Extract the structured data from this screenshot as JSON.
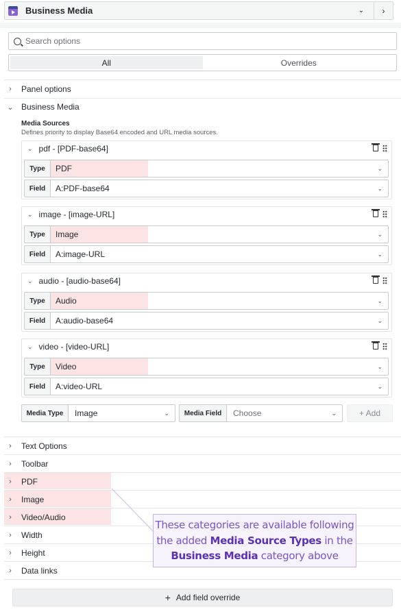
{
  "header": {
    "title": "Business Media",
    "collapse_icon": "chevron-down-icon",
    "next_icon": "chevron-right-icon"
  },
  "search": {
    "placeholder": "Search options",
    "value": ""
  },
  "tabs": [
    {
      "label": "All",
      "active": true
    },
    {
      "label": "Overrides",
      "active": false
    }
  ],
  "categories_top": [
    {
      "label": "Panel options",
      "expanded": false
    },
    {
      "label": "Business Media",
      "expanded": true
    }
  ],
  "media_sources": {
    "label": "Media Sources",
    "description": "Defines priority to display Base64 encoded and URL media sources.",
    "type_key": "Type",
    "field_key": "Field",
    "items": [
      {
        "title": "pdf - [PDF-base64]",
        "type": "PDF",
        "field": "A:PDF-base64"
      },
      {
        "title": "image - [image-URL]",
        "type": "Image",
        "field": "A:image-URL"
      },
      {
        "title": "audio - [audio-base64]",
        "type": "Audio",
        "field": "A:audio-base64"
      },
      {
        "title": "video - [video-URL]",
        "type": "Video",
        "field": "A:video-URL"
      }
    ],
    "add_bar": {
      "media_type_label": "Media Type",
      "media_type_value": "Image",
      "media_field_label": "Media Field",
      "media_field_placeholder": "Choose",
      "add_label": "+ Add"
    }
  },
  "categories_bottom": [
    {
      "label": "Text Options",
      "highlighted": false
    },
    {
      "label": "Toolbar",
      "highlighted": false
    },
    {
      "label": "PDF",
      "highlighted": true
    },
    {
      "label": "Image",
      "highlighted": true
    },
    {
      "label": "Video/Audio",
      "highlighted": true
    },
    {
      "label": "Width",
      "highlighted": false
    },
    {
      "label": "Height",
      "highlighted": false
    },
    {
      "label": "Data links",
      "highlighted": false
    }
  ],
  "callout": {
    "line1": "These categories are available following",
    "line2_pre": "the added ",
    "line2_bold": "Media Source Types",
    "line2_post": " in the",
    "line3_bold": "Business Media",
    "line3_post": " category above"
  },
  "override_button": {
    "label": "Add field override"
  },
  "colors": {
    "highlight": "#fde4e4",
    "callout_text": "#7a52cc",
    "callout_border": "#c6b4ee"
  }
}
